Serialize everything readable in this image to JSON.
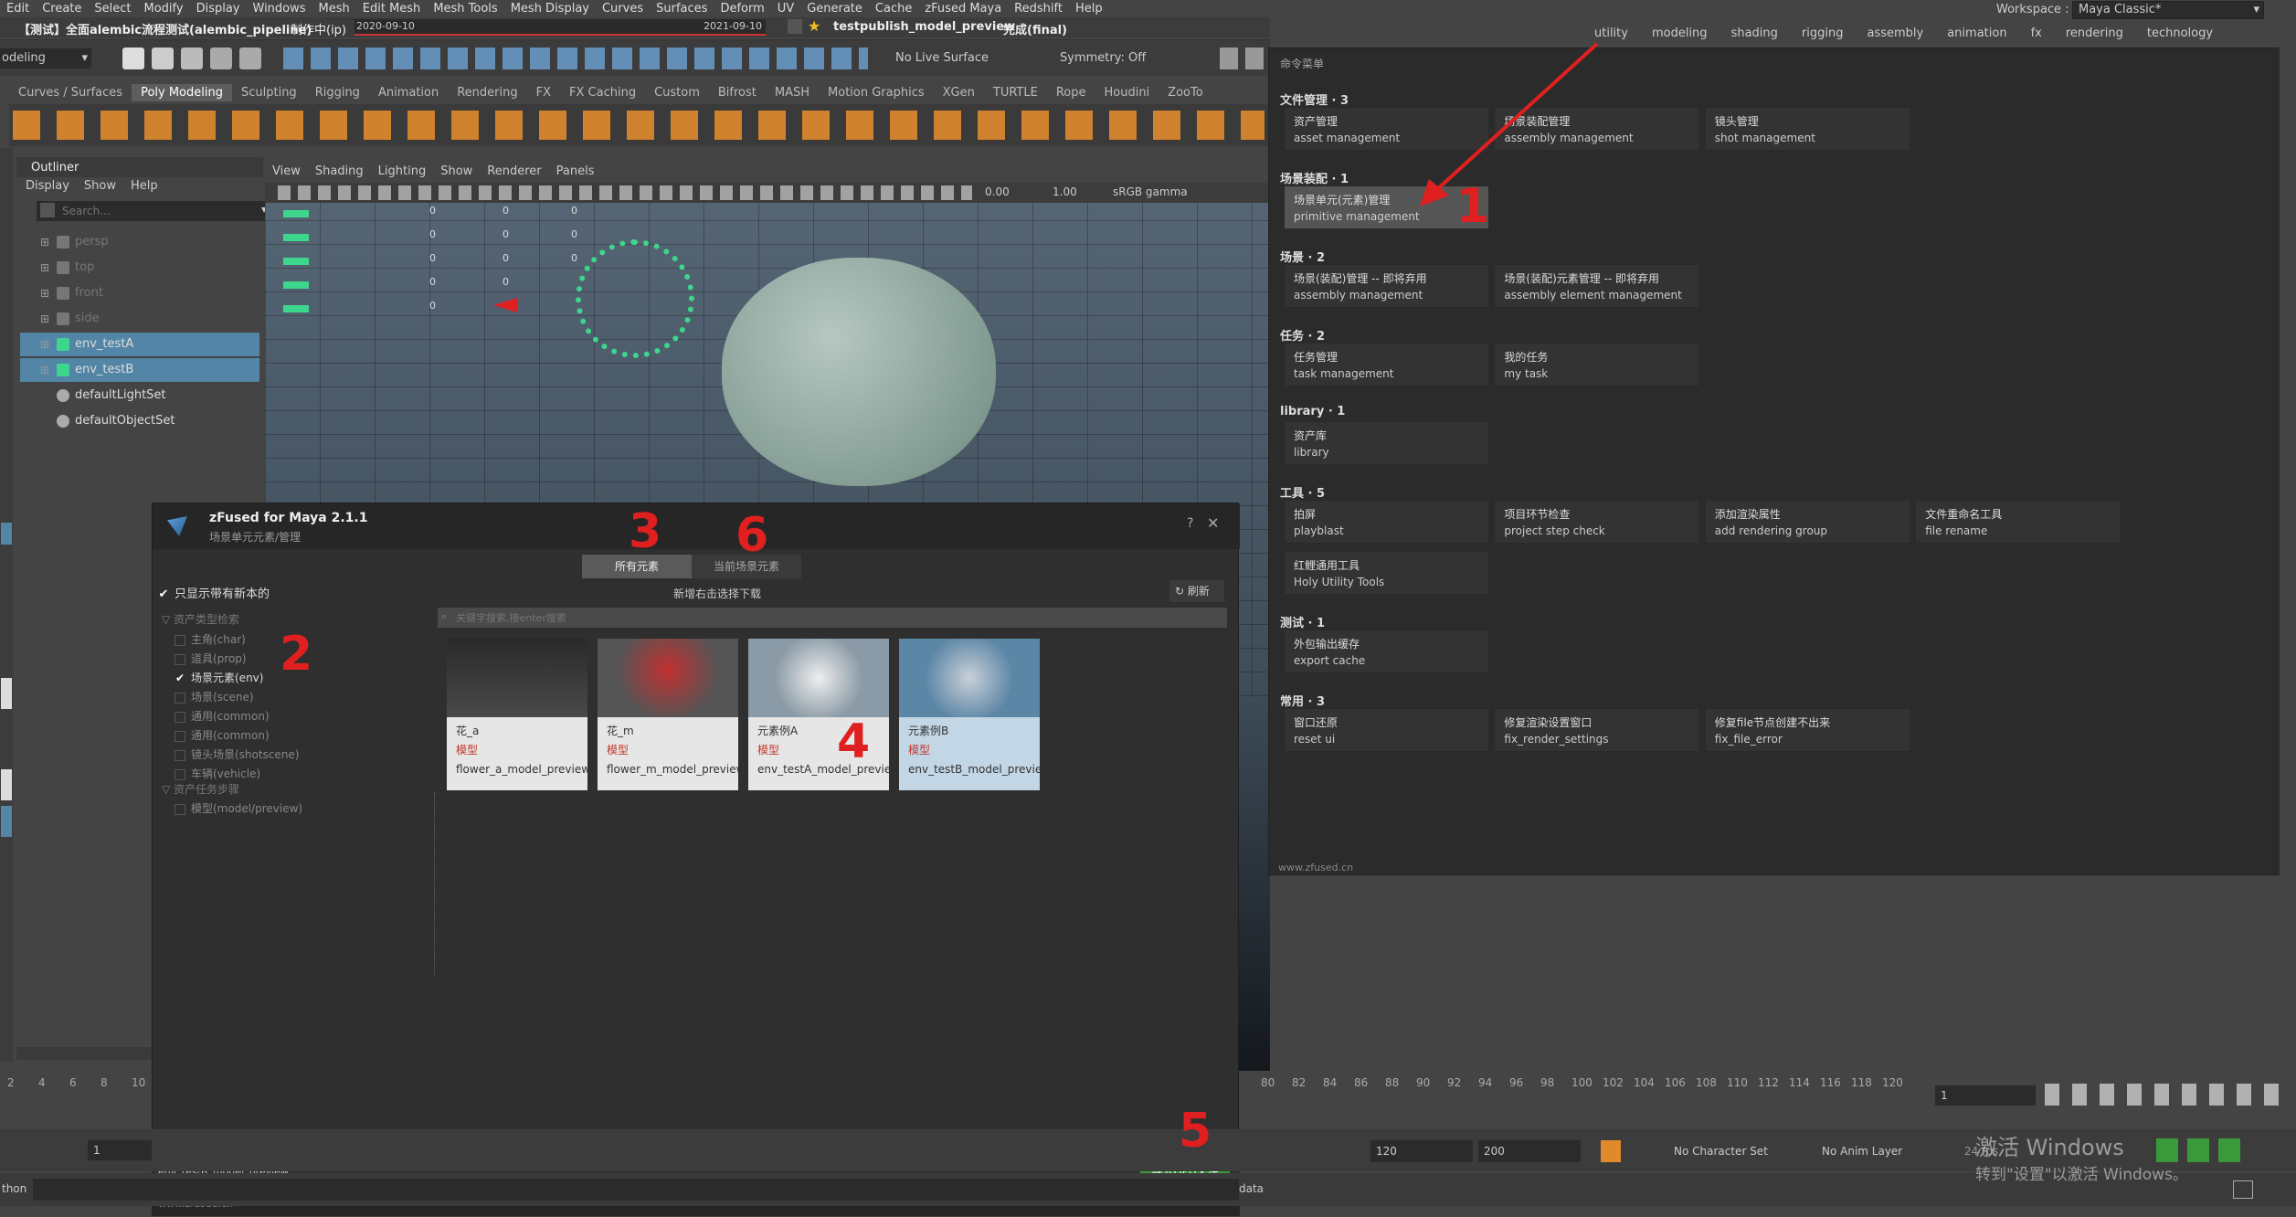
{
  "menubar": [
    "Edit",
    "Create",
    "Select",
    "Modify",
    "Display",
    "Windows",
    "Mesh",
    "Edit Mesh",
    "Mesh Tools",
    "Mesh Display",
    "Curves",
    "Surfaces",
    "Deform",
    "UV",
    "Generate",
    "Cache",
    "zFused Maya",
    "Redshift",
    "Help"
  ],
  "workspace": {
    "label": "Workspace :",
    "value": "Maya Classic*"
  },
  "titlebar": {
    "project": "【测试】全面alembic流程测试(alembic_pipeline)",
    "status": "制作中(ip)",
    "start_date": "2020-09-10",
    "end_date": "2021-09-10",
    "task": "testpublish_model_preview",
    "task_status": "完成(final)"
  },
  "toolbar": {
    "mode": "odeling",
    "live_surface": "No Live Surface",
    "symmetry": "Symmetry: Off"
  },
  "shelf_tabs": [
    "Curves / Surfaces",
    "Poly Modeling",
    "Sculpting",
    "Rigging",
    "Animation",
    "Rendering",
    "FX",
    "FX Caching",
    "Custom",
    "Bifrost",
    "MASH",
    "Motion Graphics",
    "XGen",
    "TURTLE",
    "Rope",
    "Houdini",
    "ZooTo"
  ],
  "shelf_active": "Poly Modeling",
  "workspace_tabs": [
    "utility",
    "modeling",
    "shading",
    "rigging",
    "assembly",
    "animation",
    "fx",
    "rendering",
    "technology"
  ],
  "outliner": {
    "title": "Outliner",
    "menus": [
      "Display",
      "Show",
      "Help"
    ],
    "search_placeholder": "Search...",
    "items": [
      {
        "label": "persp"
      },
      {
        "label": "top"
      },
      {
        "label": "front"
      },
      {
        "label": "side"
      },
      {
        "label": "env_testA"
      },
      {
        "label": "env_testB"
      },
      {
        "label": "defaultLightSet"
      },
      {
        "label": "defaultObjectSet"
      }
    ]
  },
  "viewport": {
    "menus": [
      "View",
      "Shading",
      "Lighting",
      "Show",
      "Renderer",
      "Panels"
    ],
    "val1": "0.00",
    "val2": "1.00",
    "colorspace": "sRGB gamma",
    "camera": "persp"
  },
  "hud_numbers": [
    "0",
    "0",
    "0",
    "0",
    "0"
  ],
  "command_menu": {
    "title": "命令菜单",
    "sections": [
      {
        "head": "文件管理 · 3",
        "buttons": [
          {
            "zh": "资产管理",
            "en": "asset management"
          },
          {
            "zh": "场景装配管理",
            "en": "assembly management"
          },
          {
            "zh": "镜头管理",
            "en": "shot management"
          }
        ]
      },
      {
        "head": "场景装配 · 1",
        "buttons": [
          {
            "zh": "场景单元(元素)管理",
            "en": "primitive management"
          }
        ]
      },
      {
        "head": "场景 · 2",
        "buttons": [
          {
            "zh": "场景(装配)管理 -- 即将弃用",
            "en": "assembly management"
          },
          {
            "zh": "场景(装配)元素管理 -- 即将弃用",
            "en": "assembly element management"
          }
        ]
      },
      {
        "head": "任务 · 2",
        "buttons": [
          {
            "zh": "任务管理",
            "en": "task management"
          },
          {
            "zh": "我的任务",
            "en": "my task"
          }
        ]
      },
      {
        "head": "library · 1",
        "buttons": [
          {
            "zh": "资产库",
            "en": "library"
          }
        ]
      },
      {
        "head": "工具 · 5",
        "buttons": [
          {
            "zh": "拍屏",
            "en": "playblast"
          },
          {
            "zh": "项目环节检查",
            "en": "project step check"
          },
          {
            "zh": "添加渲染属性",
            "en": "add rendering group"
          },
          {
            "zh": "文件重命名工具",
            "en": "file rename"
          },
          {
            "zh": "红鲤通用工具",
            "en": "Holy Utility Tools"
          }
        ]
      },
      {
        "head": "测试 · 1",
        "buttons": [
          {
            "zh": "外包输出缓存",
            "en": "export cache"
          }
        ]
      },
      {
        "head": "常用 · 3",
        "buttons": [
          {
            "zh": "窗口还原",
            "en": "reset ui"
          },
          {
            "zh": "修复渲染设置窗口",
            "en": "fix_render_settings"
          },
          {
            "zh": "修复file节点创建不出来",
            "en": "fix_file_error"
          }
        ]
      }
    ],
    "footer": "www.zfused.cn"
  },
  "dialog": {
    "title": "zFused for Maya 2.1.1",
    "subtitle": "场景单元元素/管理",
    "tabs": [
      "所有元素",
      "当前场景元素"
    ],
    "only_new": "只显示带有新本的",
    "filter_head1": "资产类型检索",
    "filters": [
      {
        "label": "主角(char)",
        "checked": false
      },
      {
        "label": "道具(prop)",
        "checked": false
      },
      {
        "label": "场景元素(env)",
        "checked": true
      },
      {
        "label": "场景(scene)",
        "checked": false
      },
      {
        "label": "通用(common)",
        "checked": false
      },
      {
        "label": "通用(common)",
        "checked": false
      },
      {
        "label": "镜头场景(shotscene)",
        "checked": false
      },
      {
        "label": "车辆(vehicle)",
        "checked": false
      }
    ],
    "filter_head2": "资产任务步骤",
    "filters2": [
      {
        "label": "模型(model/preview)",
        "checked": false
      }
    ],
    "hint": "新增右击选择下载",
    "refresh": "刷新",
    "search_placeholder": "关键字搜索,接enter搜索",
    "cards": [
      {
        "name": "花_a",
        "type": "模型",
        "file": "flower_a_model_preview"
      },
      {
        "name": "花_m",
        "type": "模型",
        "file": "flower_m_model_preview"
      },
      {
        "name": "元素例A",
        "type": "模型",
        "file": "env_testA_model_preview"
      },
      {
        "name": "元素例B",
        "type": "模型",
        "file": "env_testB_model_preview"
      }
    ],
    "selected_file": "env_testB_model_preview",
    "import_btn": "导入GPU文件",
    "footer": "www.zfused.cn"
  },
  "timeline": {
    "ticks": [
      "2",
      "4",
      "6",
      "8",
      "10"
    ],
    "ticks_right": [
      "80",
      "82",
      "84",
      "86",
      "88",
      "90",
      "92",
      "94",
      "96",
      "98",
      "100",
      "102",
      "104",
      "106",
      "108",
      "110",
      "112",
      "114",
      "116",
      "118",
      "120"
    ],
    "current": "1"
  },
  "range": {
    "start": "1",
    "end1": "120",
    "end2": "200",
    "char_set": "No Character Set",
    "anim_layer": "No Anim Layer",
    "fps": "24 fps"
  },
  "cmdline": {
    "left": "thon",
    "right": "data"
  },
  "watermark": {
    "line1": "激活 Windows",
    "line2": "转到\"设置\"以激活 Windows。"
  },
  "annotations": [
    "1",
    "2",
    "3",
    "4",
    "5",
    "6"
  ],
  "colors": {
    "accent_green": "#3a9a3a",
    "selected_blue": "#5285a6",
    "annotation_red": "#e02020"
  }
}
